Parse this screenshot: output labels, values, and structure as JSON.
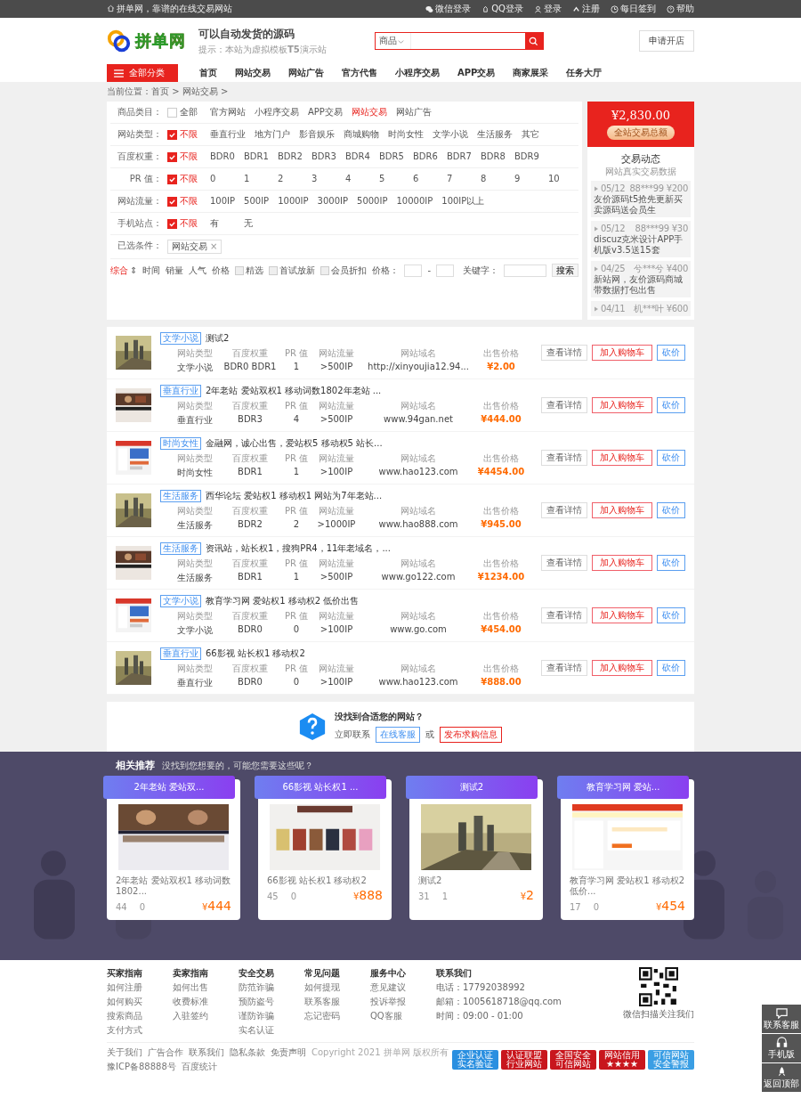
{
  "topbar": {
    "welcome": "拼单网，靠谱的在线交易网站",
    "links": [
      {
        "label": "微信登录"
      },
      {
        "label": "QQ登录"
      },
      {
        "label": "登录"
      },
      {
        "label": "注册"
      },
      {
        "label": "每日签到"
      },
      {
        "label": "帮助"
      }
    ]
  },
  "header": {
    "logo_text": "拼单网",
    "slogan": "可以自动发货的源码",
    "hint": "提示：本站为虚拟模板**T5**演示站",
    "search": {
      "category": "商品"
    },
    "apply_button": "申请开店"
  },
  "nav": {
    "all_button": "全部分类",
    "items": [
      "首页",
      "网站交易",
      "网站广告",
      "官方代售",
      "小程序交易",
      "APP交易",
      "商家展采",
      "任务大厅"
    ]
  },
  "breadcrumb": "当前位置：首页 > 网站交易 >",
  "filters": [
    {
      "label": "商品类目：",
      "all": {
        "label": "全部",
        "checked": false
      },
      "options": [
        {
          "label": "官方网站",
          "selected": false
        },
        {
          "label": "小程序交易",
          "selected": false
        },
        {
          "label": "APP交易",
          "selected": false
        },
        {
          "label": "网站交易",
          "selected": true
        },
        {
          "label": "网站广告",
          "selected": false
        }
      ]
    },
    {
      "label": "网站类型：",
      "all": {
        "label": "不限",
        "checked": true
      },
      "options": [
        {
          "label": "垂直行业",
          "selected": false
        },
        {
          "label": "地方门户",
          "selected": false
        },
        {
          "label": "影音娱乐",
          "selected": false
        },
        {
          "label": "商城购物",
          "selected": false
        },
        {
          "label": "时尚女性",
          "selected": false
        },
        {
          "label": "文学小说",
          "selected": false
        },
        {
          "label": "生活服务",
          "selected": false
        },
        {
          "label": "其它",
          "selected": false
        }
      ]
    },
    {
      "label": "百度权重：",
      "all": {
        "label": "不限",
        "checked": true
      },
      "options": [
        {
          "label": "BDR0",
          "selected": false
        },
        {
          "label": "BDR1",
          "selected": false
        },
        {
          "label": "BDR2",
          "selected": false
        },
        {
          "label": "BDR3",
          "selected": false
        },
        {
          "label": "BDR4",
          "selected": false
        },
        {
          "label": "BDR5",
          "selected": false
        },
        {
          "label": "BDR6",
          "selected": false
        },
        {
          "label": "BDR7",
          "selected": false
        },
        {
          "label": "BDR8",
          "selected": false
        },
        {
          "label": "BDR9",
          "selected": false
        }
      ]
    },
    {
      "label": "PR 值：",
      "all": {
        "label": "不限",
        "checked": true
      },
      "options": [
        {
          "label": "0",
          "selected": false
        },
        {
          "label": "1",
          "selected": false
        },
        {
          "label": "2",
          "selected": false
        },
        {
          "label": "3",
          "selected": false
        },
        {
          "label": "4",
          "selected": false
        },
        {
          "label": "5",
          "selected": false
        },
        {
          "label": "6",
          "selected": false
        },
        {
          "label": "7",
          "selected": false
        },
        {
          "label": "8",
          "selected": false
        },
        {
          "label": "9",
          "selected": false
        },
        {
          "label": "10",
          "selected": false
        }
      ]
    },
    {
      "label": "网站流量：",
      "all": {
        "label": "不限",
        "checked": true
      },
      "options": [
        {
          "label": "100IP",
          "selected": false
        },
        {
          "label": "500IP",
          "selected": false
        },
        {
          "label": "1000IP",
          "selected": false
        },
        {
          "label": "3000IP",
          "selected": false
        },
        {
          "label": "5000IP",
          "selected": false
        },
        {
          "label": "10000IP",
          "selected": false
        },
        {
          "label": "100IP以上",
          "selected": false
        }
      ]
    },
    {
      "label": "手机站点：",
      "all": {
        "label": "不限",
        "checked": true
      },
      "options": [
        {
          "label": "有",
          "selected": false
        },
        {
          "label": "无",
          "selected": false
        }
      ]
    }
  ],
  "chosen": {
    "label": "已选条件：",
    "tags": [
      {
        "label": "网站交易",
        "remove": "×"
      }
    ]
  },
  "sort": {
    "sorts": [
      {
        "label": "综合",
        "selected": true,
        "arrow": "⇕"
      },
      {
        "label": "时间",
        "selected": false
      },
      {
        "label": "销量",
        "selected": false
      },
      {
        "label": "人气",
        "selected": false
      },
      {
        "label": "价格",
        "selected": false
      }
    ],
    "checks": [
      {
        "label": "精选",
        "checked": false
      },
      {
        "label": "首试放新",
        "checked": false
      },
      {
        "label": "会员折扣",
        "checked": false
      }
    ],
    "price_label": "价格：",
    "dash": "-",
    "keyword_label": "关键字：",
    "search_button": "搜索"
  },
  "stats": {
    "amount": "¥2,830.00",
    "button": "全站交易总额",
    "title": "交易动态",
    "subtitle": "网站真实交易数据",
    "trades": [
      {
        "date": "05/12",
        "user": "88***99",
        "price": "¥200",
        "title": "友价源码t5抢先更新买卖源码送会员生"
      },
      {
        "date": "05/12",
        "user": "88***99",
        "price": "¥30",
        "title": "discuz克米设计APP手机版v3.5送15套"
      },
      {
        "date": "04/25",
        "user": "兮***兮",
        "price": "¥400",
        "title": "新站网，友价源码商城带数据打包出售"
      },
      {
        "date": "04/11",
        "user": "机***叶",
        "price": "¥600"
      }
    ]
  },
  "listings": [
    {
      "tag": "文学小说",
      "title": "测试2",
      "fields": [
        {
          "label": "网站类型",
          "value": "文学小说"
        },
        {
          "label": "百度权重",
          "value": "BDR0 BDR1"
        },
        {
          "label": "PR 值",
          "value": "1"
        },
        {
          "label": "网站流量",
          "value": ">500IP"
        },
        {
          "label": "网站域名",
          "value": "http://xinyoujia12.94..."
        },
        {
          "label": "出售价格",
          "value": "¥2.00"
        }
      ],
      "buttons": [
        "查看详情",
        "加入购物车",
        "砍价"
      ]
    },
    {
      "tag": "垂直行业",
      "title": "2年老站 爱站双权1 移动词数1802年老站 ...",
      "fields": [
        {
          "label": "网站类型",
          "value": "垂直行业"
        },
        {
          "label": "百度权重",
          "value": "BDR3"
        },
        {
          "label": "PR 值",
          "value": "4"
        },
        {
          "label": "网站流量",
          "value": ">500IP"
        },
        {
          "label": "网站域名",
          "value": "www.94gan.net"
        },
        {
          "label": "出售价格",
          "value": "¥444.00"
        }
      ],
      "buttons": [
        "查看详情",
        "加入购物车",
        "砍价"
      ]
    },
    {
      "tag": "时尚女性",
      "title": "金融网，诚心出售，爱站权5 移动权5 站长...",
      "fields": [
        {
          "label": "网站类型",
          "value": "时尚女性"
        },
        {
          "label": "百度权重",
          "value": "BDR1"
        },
        {
          "label": "PR 值",
          "value": "1"
        },
        {
          "label": "网站流量",
          "value": ">100IP"
        },
        {
          "label": "网站域名",
          "value": "www.hao123.com"
        },
        {
          "label": "出售价格",
          "value": "¥4454.00"
        }
      ],
      "buttons": [
        "查看详情",
        "加入购物车",
        "砍价"
      ]
    },
    {
      "tag": "生活服务",
      "title": "西华论坛 爱站权1 移动权1 网站为7年老站...",
      "fields": [
        {
          "label": "网站类型",
          "value": "生活服务"
        },
        {
          "label": "百度权重",
          "value": "BDR2"
        },
        {
          "label": "PR 值",
          "value": "2"
        },
        {
          "label": "网站流量",
          "value": ">1000IP"
        },
        {
          "label": "网站域名",
          "value": "www.hao888.com"
        },
        {
          "label": "出售价格",
          "value": "¥945.00"
        }
      ],
      "buttons": [
        "查看详情",
        "加入购物车",
        "砍价"
      ]
    },
    {
      "tag": "生活服务",
      "title": "资讯站，站长权1，搜狗PR4，11年老域名，...",
      "fields": [
        {
          "label": "网站类型",
          "value": "生活服务"
        },
        {
          "label": "百度权重",
          "value": "BDR1"
        },
        {
          "label": "PR 值",
          "value": "1"
        },
        {
          "label": "网站流量",
          "value": ">500IP"
        },
        {
          "label": "网站域名",
          "value": "www.go122.com"
        },
        {
          "label": "出售价格",
          "value": "¥1234.00"
        }
      ],
      "buttons": [
        "查看详情",
        "加入购物车",
        "砍价"
      ]
    },
    {
      "tag": "文学小说",
      "title": "教育学习网 爱站权1 移动权2 低价出售",
      "fields": [
        {
          "label": "网站类型",
          "value": "文学小说"
        },
        {
          "label": "百度权重",
          "value": "BDR0"
        },
        {
          "label": "PR 值",
          "value": "0"
        },
        {
          "label": "网站流量",
          "value": ">100IP"
        },
        {
          "label": "网站域名",
          "value": "www.go.com"
        },
        {
          "label": "出售价格",
          "value": "¥454.00"
        }
      ],
      "buttons": [
        "查看详情",
        "加入购物车",
        "砍价"
      ]
    },
    {
      "tag": "垂直行业",
      "title": "66影视 站长权1 移动权2",
      "fields": [
        {
          "label": "网站类型",
          "value": "垂直行业"
        },
        {
          "label": "百度权重",
          "value": "BDR0"
        },
        {
          "label": "PR 值",
          "value": "0"
        },
        {
          "label": "网站流量",
          "value": ">100IP"
        },
        {
          "label": "网站域名",
          "value": "www.hao123.com"
        },
        {
          "label": "出售价格",
          "value": "¥888.00"
        }
      ],
      "buttons": [
        "查看详情",
        "加入购物车",
        "砍价"
      ]
    }
  ],
  "help": {
    "question": "没找到合适您的网站？",
    "contact": "立即联系",
    "service_link": "在线客服",
    "or": "或",
    "post_link": "发布求购信息"
  },
  "recommend": {
    "title": "相关推荐",
    "subtitle": "没找到您想要的，可能您需要这些呢？",
    "cards": [
      {
        "heading": "2年老站 爱站双...",
        "caption": "2年老站 爱站双权1 移动词数1802...",
        "views": "44",
        "count": "0",
        "currency": "¥",
        "price": "444"
      },
      {
        "heading": "66影视 站长权1 ...",
        "caption": "66影视 站长权1 移动权2",
        "views": "45",
        "count": "0",
        "currency": "¥",
        "price": "888"
      },
      {
        "heading": "测试2",
        "caption": "测试2",
        "views": "31",
        "count": "1",
        "currency": "¥",
        "price": "2"
      },
      {
        "heading": "教育学习网 爱站...",
        "caption": "教育学习网 爱站权1 移动权2 低价...",
        "views": "17",
        "count": "0",
        "currency": "¥",
        "price": "454"
      }
    ]
  },
  "footer": {
    "columns": [
      {
        "title": "买家指南",
        "links": [
          "如何注册",
          "如何购买",
          "搜索商品",
          "支付方式"
        ]
      },
      {
        "title": "卖家指南",
        "links": [
          "如何出售",
          "收费标准",
          "入驻签约"
        ]
      },
      {
        "title": "安全交易",
        "links": [
          "防范诈骗",
          "预防盗号",
          "谨防诈骗",
          "实名认证"
        ]
      },
      {
        "title": "常见问题",
        "links": [
          "如何提现",
          "联系客服",
          "忘记密码"
        ]
      },
      {
        "title": "服务中心",
        "links": [
          "意见建议",
          "投诉举报",
          "QQ客服"
        ]
      }
    ],
    "contact": {
      "title": "联系我们",
      "lines": [
        "电话：17792038992",
        "邮箱：1005618718@qq.com",
        "时间：09:00 - 01:00"
      ]
    },
    "qr_caption": "微信扫描关注我们",
    "bottom_links": [
      "关于我们",
      "广告合作",
      "联系我们",
      "隐私条款",
      "免责声明"
    ],
    "copyright": "Copyright 2021 拼单网 版权所有",
    "icp": "豫ICP备88888号",
    "stats_link": "百度统计",
    "badges": [
      {
        "top": "企业认证",
        "bottom": "实名验证",
        "color": "#2a8fe0"
      },
      {
        "top": "认证联盟",
        "bottom": "行业网站",
        "color": "#c8161d"
      },
      {
        "top": "全国安全",
        "bottom": "可信网站",
        "color": "#c8161d"
      },
      {
        "top": "网站信用",
        "bottom": "★★★★",
        "color": "#c8161d"
      },
      {
        "top": "可信网站",
        "bottom": "安全警报",
        "color": "#3a9ee4"
      }
    ]
  },
  "side": [
    {
      "label": "联系客服"
    },
    {
      "label": "手机版"
    },
    {
      "label": "返回顶部"
    }
  ]
}
